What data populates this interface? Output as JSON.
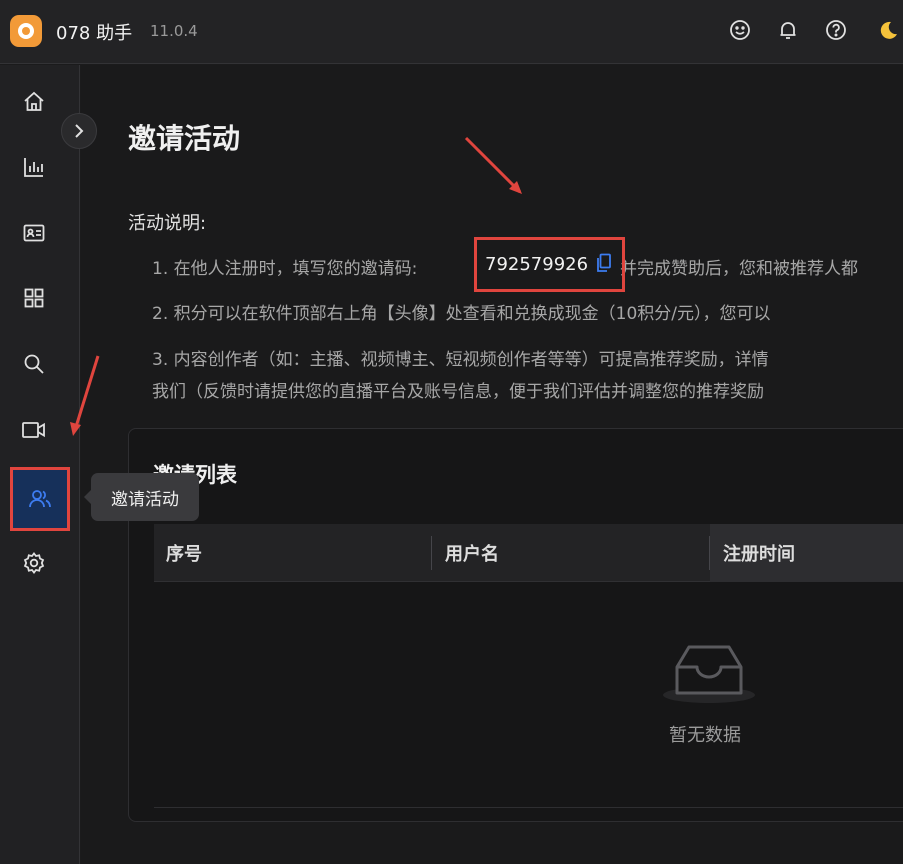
{
  "app": {
    "name": "078 助手",
    "version": "11.0.4"
  },
  "page": {
    "title": "邀请活动",
    "desc_heading": "活动说明:",
    "line1_prefix": "1. 在他人注册时，填写您的邀请码:",
    "invite_code": "792579926",
    "line1_suffix": "并完成赞助后，您和被推荐人都",
    "line2": "2. 积分可以在软件顶部右上角【头像】处查看和兑换成现金（10积分/元），您可以",
    "line3a": "3. 内容创作者（如：主播、视频博主、短视频创作者等等）可提高推荐奖励，详情",
    "line3b": "我们（反馈时请提供您的直播平台及账号信息，便于我们评估并调整您的推荐奖励"
  },
  "panel": {
    "title": "邀请列表",
    "columns": [
      "序号",
      "用户名",
      "注册时间"
    ],
    "empty_text": "暂无数据"
  },
  "sidebar": {
    "tooltip": "邀请活动",
    "items": [
      "home-icon",
      "chart-icon",
      "id-card-icon",
      "grid-icon",
      "search-icon",
      "video-icon",
      "invite-icon",
      "settings-icon"
    ]
  },
  "colors": {
    "accent": "#3d7cf0",
    "highlight": "#e0453e",
    "logo": "#f29a38"
  }
}
